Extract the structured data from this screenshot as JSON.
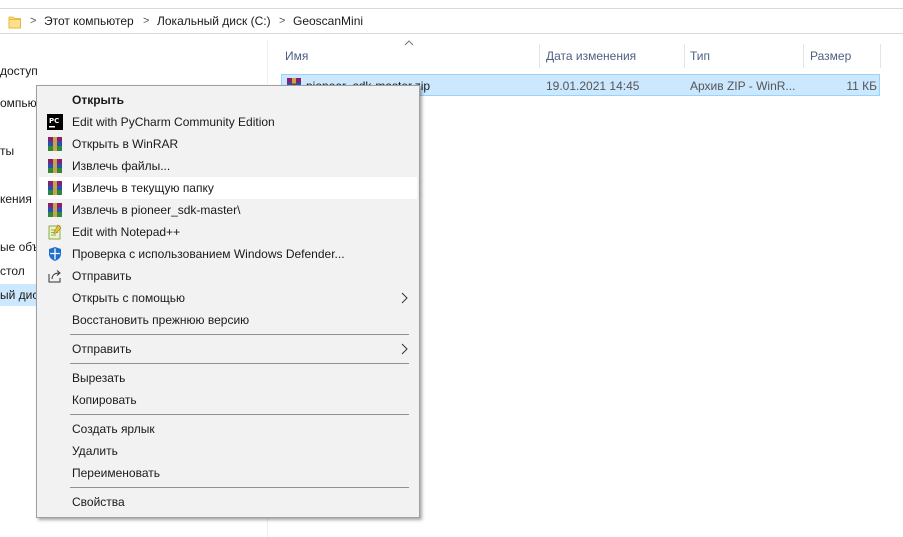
{
  "address_bar": {
    "crumbs": [
      "Этот компьютер",
      "Локальный диск (C:)",
      "GeoscanMini"
    ],
    "separator": ">"
  },
  "nav_pane": {
    "items": [
      "доступ",
      "омпьютер",
      "ты",
      "кения",
      "ые объ",
      "стол",
      "ый дис"
    ],
    "selected_index": 6
  },
  "columns": {
    "name": "Имя",
    "date": "Дата изменения",
    "type": "Тип",
    "size": "Размер",
    "sorted_by": "name"
  },
  "file": {
    "name": "pioneer_sdk-master.zip",
    "date": "19.01.2021 14:45",
    "type": "Архив ZIP - WinR...",
    "size": "11 КБ",
    "icon": "winrar-archive-icon"
  },
  "context_menu": {
    "groups": [
      [
        {
          "label": "Открыть",
          "bold": true,
          "icon": ""
        },
        {
          "label": "Edit with PyCharm Community Edition",
          "icon": "pycharm-icon"
        },
        {
          "label": "Открыть в WinRAR",
          "icon": "winrar-icon"
        },
        {
          "label": "Извлечь файлы...",
          "icon": "winrar-icon"
        },
        {
          "label": "Извлечь в текущую папку",
          "icon": "winrar-icon",
          "hover": true
        },
        {
          "label": "Извлечь в pioneer_sdk-master\\",
          "icon": "winrar-icon"
        },
        {
          "label": "Edit with Notepad++",
          "icon": "notepadpp-icon"
        },
        {
          "label": "Проверка с использованием Windows Defender...",
          "icon": "windows-defender-icon"
        },
        {
          "label": "Отправить",
          "icon": "share-icon"
        },
        {
          "label": "Открыть с помощью",
          "icon": "",
          "submenu": true
        },
        {
          "label": "Восстановить прежнюю версию",
          "icon": ""
        }
      ],
      [
        {
          "label": "Отправить",
          "icon": "",
          "submenu": true
        }
      ],
      [
        {
          "label": "Вырезать",
          "icon": ""
        },
        {
          "label": "Копировать",
          "icon": ""
        }
      ],
      [
        {
          "label": "Создать ярлык",
          "icon": ""
        },
        {
          "label": "Удалить",
          "icon": ""
        },
        {
          "label": "Переименовать",
          "icon": ""
        }
      ],
      [
        {
          "label": "Свойства",
          "icon": ""
        }
      ]
    ]
  },
  "colors": {
    "selection": "#cce8ff",
    "selection_border": "#99d1ff",
    "menu_bg": "#f2f2f2",
    "menu_hover": "#ffffff"
  }
}
